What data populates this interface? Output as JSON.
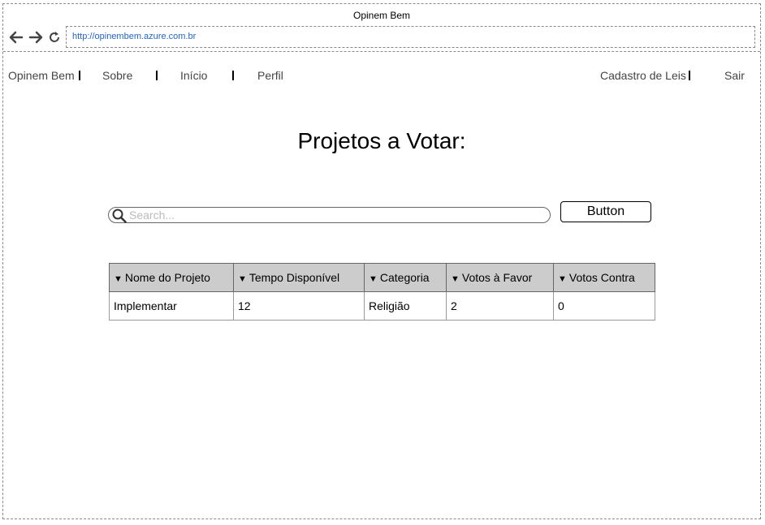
{
  "window": {
    "title": "Opinem Bem",
    "url": "http://opinembem.azure.com.br"
  },
  "navigation": {
    "back_icon": "arrow-left-icon",
    "forward_icon": "arrow-right-icon",
    "reload_icon": "reload-icon"
  },
  "menu": {
    "brand": "Opinem Bem",
    "items": [
      "Sobre",
      "Início",
      "Perfil"
    ],
    "right_items": [
      "Cadastro de Leis",
      "Sair"
    ]
  },
  "page": {
    "title": "Projetos a Votar:"
  },
  "search": {
    "icon": "search-icon",
    "placeholder": "Search..."
  },
  "action_button": {
    "label": "Button"
  },
  "table": {
    "sort_glyph": "▼",
    "columns": [
      "Nome do Projeto",
      "Tempo Disponível",
      "Categoria",
      "Votos à Favor",
      "Votos Contra"
    ],
    "rows": [
      [
        "Implementar",
        "12",
        "Religião",
        "2",
        "0"
      ]
    ]
  },
  "colors": {
    "header_bg": "#cccccc",
    "url_text": "#2266cc",
    "border": "#8a8a8a"
  }
}
